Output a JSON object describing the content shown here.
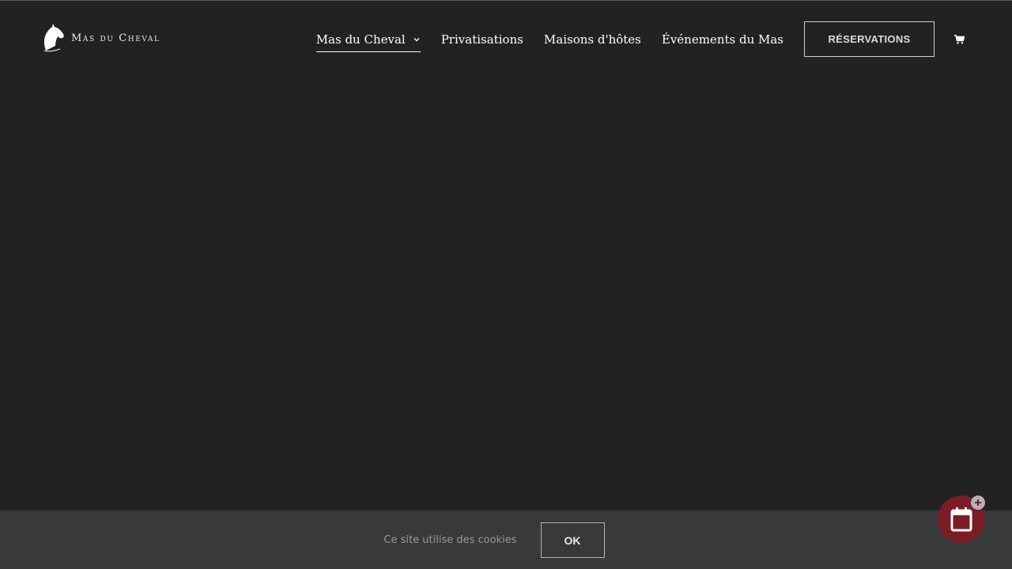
{
  "brand": {
    "name": "Mas du Cheval",
    "logo_icon": "horse-head-icon"
  },
  "nav": {
    "items": [
      {
        "label": "Mas du Cheval",
        "active": true,
        "has_dropdown": true
      },
      {
        "label": "Privatisations",
        "active": false,
        "has_dropdown": false
      },
      {
        "label": "Maisons d'hôtes",
        "active": false,
        "has_dropdown": false
      },
      {
        "label": "Événements du Mas",
        "active": false,
        "has_dropdown": false
      }
    ],
    "reservations_label": "RÉSERVATIONS",
    "cart_icon": "shopping-cart-icon"
  },
  "cookie": {
    "text": "Ce site utilise des cookies",
    "ok_label": "OK"
  },
  "booking_widget": {
    "icon": "calendar-icon",
    "badge_icon": "plus-icon"
  },
  "colors": {
    "background": "#222222",
    "cookie_bar": "#38393b",
    "accent": "#7a1d25"
  }
}
